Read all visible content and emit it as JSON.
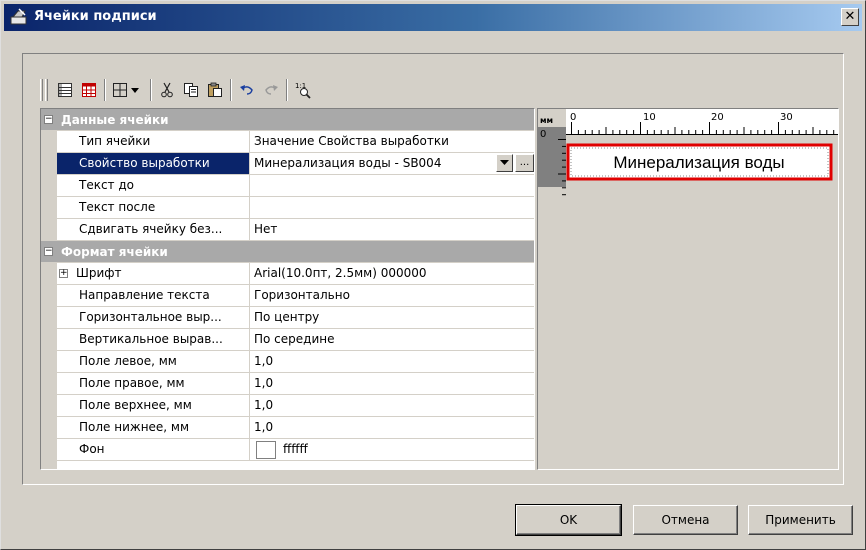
{
  "window": {
    "title": "Ячейки подписи",
    "close_glyph": "✕"
  },
  "toolbar": {
    "buttons": [
      "categorized-icon",
      "alphabetic-icon",
      "table-layout-icon",
      "cut-icon",
      "copy-icon",
      "paste-icon",
      "undo-icon",
      "redo-icon",
      "zoom-1to1-icon"
    ],
    "zoom_label": "1:1"
  },
  "properties": {
    "data_category": "Данные ячейки",
    "data_rows": [
      {
        "name": "Тип ячейки",
        "value": "Значение Свойства выработки"
      },
      {
        "name": "Свойство выработки",
        "value": "Минерализация воды - SB004"
      },
      {
        "name": "Текст до",
        "value": ""
      },
      {
        "name": "Текст после",
        "value": ""
      },
      {
        "name": "Сдвигать ячейку без...",
        "value": "Нет"
      }
    ],
    "format_category": "Формат ячейки",
    "format_rows": [
      {
        "name": "Шрифт",
        "value": "Arial(10.0пт, 2.5мм) 000000"
      },
      {
        "name": "Направление текста",
        "value": "Горизонтально"
      },
      {
        "name": "Горизонтальное выр...",
        "value": "По центру"
      },
      {
        "name": "Вертикальное вырав...",
        "value": "По середине"
      },
      {
        "name": "Поле левое, мм",
        "value": "1,0"
      },
      {
        "name": "Поле правое, мм",
        "value": "1,0"
      },
      {
        "name": "Поле верхнее, мм",
        "value": "1,0"
      },
      {
        "name": "Поле нижнее, мм",
        "value": "1,0"
      },
      {
        "name": "Фон",
        "value": "ffffff"
      }
    ],
    "collapse_glyph": "−",
    "expand_glyph": "+",
    "ellipsis": "..."
  },
  "preview": {
    "ruler_unit": "мм",
    "ruler_ticks": [
      "0",
      "10",
      "20",
      "30"
    ],
    "ruler_v_tick": "0",
    "cell_text": "Минерализация воды"
  },
  "buttons": {
    "ok": "OK",
    "cancel": "Отмена",
    "apply": "Применить"
  },
  "colors": {
    "selection": "#0a246a",
    "category": "#a9a9a9",
    "highlight_border": "#e00000"
  }
}
